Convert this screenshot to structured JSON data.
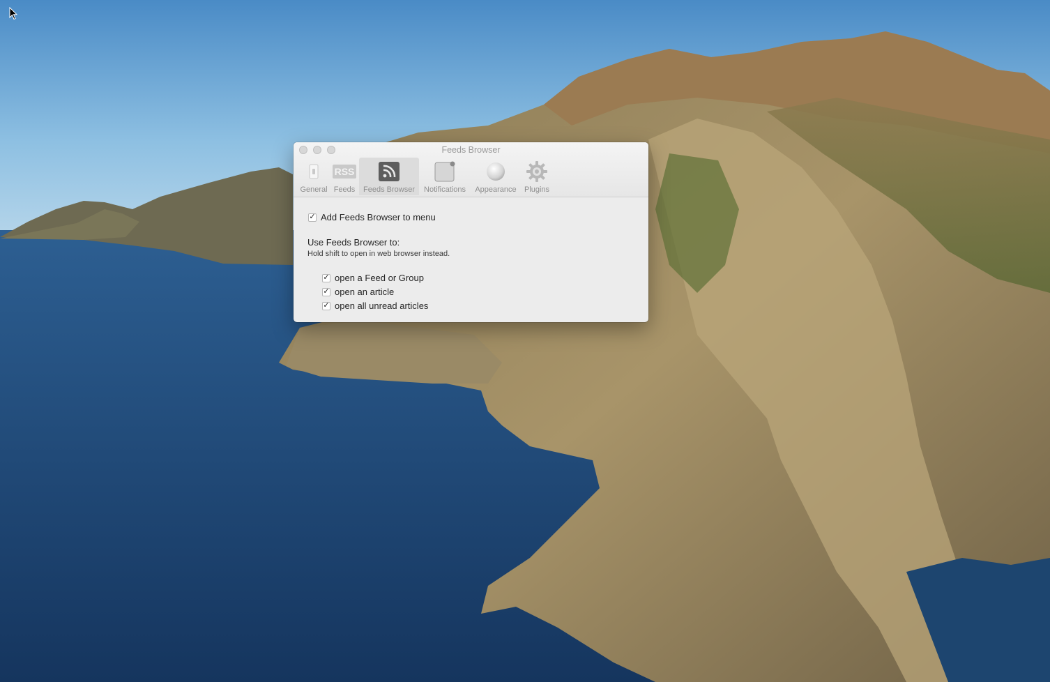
{
  "window": {
    "title": "Feeds Browser"
  },
  "toolbar": {
    "items": [
      {
        "label": "General",
        "icon": "switch-icon"
      },
      {
        "label": "Feeds",
        "icon": "rss-icon"
      },
      {
        "label": "Feeds Browser",
        "icon": "feed-icon"
      },
      {
        "label": "Notifications",
        "icon": "notification-icon"
      },
      {
        "label": "Appearance",
        "icon": "sphere-icon"
      },
      {
        "label": "Plugins",
        "icon": "gear-icon"
      }
    ],
    "selected": "Feeds Browser",
    "rss_text": "RSS"
  },
  "settings": {
    "add_to_menu": {
      "label": "Add Feeds Browser to menu",
      "checked": true
    },
    "use_heading": "Use Feeds Browser to:",
    "hint": "Hold shift to open in web browser instead.",
    "options": [
      {
        "label": "open a Feed or Group",
        "checked": true
      },
      {
        "label": "open an article",
        "checked": true
      },
      {
        "label": "open all unread articles",
        "checked": true
      }
    ],
    "check_glyph": "✓"
  }
}
